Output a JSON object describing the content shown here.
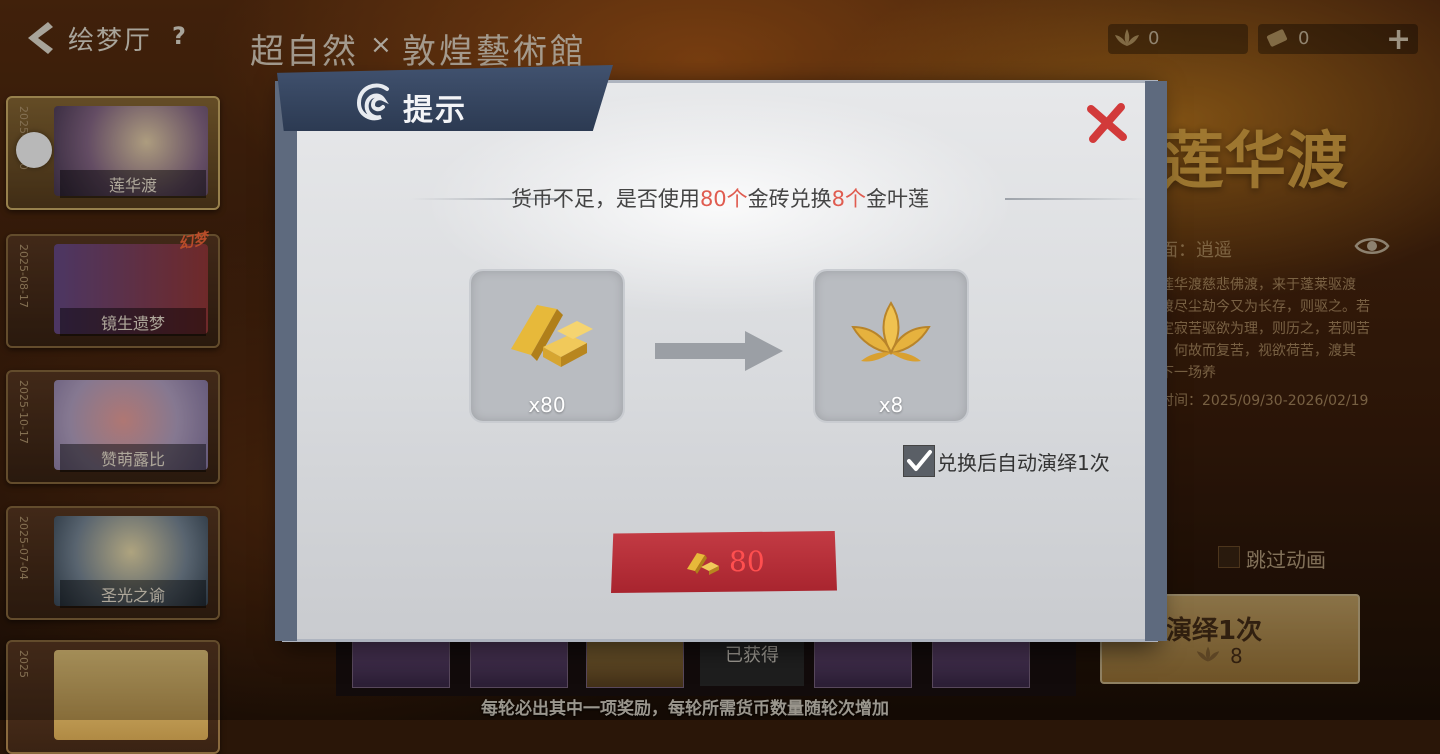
{
  "header": {
    "back_icon": "back-arrow-icon",
    "title": "绘梦厅",
    "help": "?",
    "collab_logo": "超自然",
    "collab_x": "×",
    "collab_museum": "敦煌藝術館"
  },
  "currency": [
    {
      "icon": "gold-lotus-icon",
      "value": "0"
    },
    {
      "icon": "scroll-ticket-icon",
      "value": "0"
    }
  ],
  "plus": "+",
  "event_list": [
    {
      "name": "莲华渡",
      "date": "2025-09-30",
      "active": true
    },
    {
      "name": "镜生遗梦",
      "date": "2025-08-17",
      "badge": "幻梦"
    },
    {
      "name": "赞萌露比",
      "date": "2025-10-17"
    },
    {
      "name": "圣光之谕",
      "date": "2025-07-04"
    },
    {
      "name": "",
      "date": "2025"
    }
  ],
  "event_info": {
    "big_title": "莲华渡",
    "lines": [
      "面：逍遥",
      "莲华渡慈悲佛渡，来于蓬莱驱渡",
      "渡尽尘劫今又为长存，则驱之。若",
      "定寂苦驱欲为理，则历之，若则苦",
      "，何故而复苦，视欲荷苦，渡其",
      "下一场养",
      "时间：2025/09/30-2026/02/19"
    ]
  },
  "skip_label": "跳过动画",
  "perform": {
    "label": "演绎1次",
    "cost": "8"
  },
  "rewards": {
    "obtained_label": "已获得"
  },
  "bottom_hint": "每轮必出其中一项奖励，每轮所需货币数量随轮次增加",
  "modal": {
    "title": "提示",
    "prompt_pre": "货币不足，是否使用",
    "prompt_amount1": "80个",
    "prompt_mid": "金砖兑换",
    "prompt_amount2": "8个",
    "prompt_post": "金叶莲",
    "from_item": {
      "icon": "gold-brick-icon",
      "qty": "x80"
    },
    "to_item": {
      "icon": "golden-lotus-icon",
      "qty": "x8"
    },
    "auto_checked": true,
    "auto_label": "兑换后自动演绎1次",
    "confirm_cost": "80"
  },
  "colors": {
    "highlight": "#e05c50",
    "confirm_bg": "#b42d37",
    "modal_bg": "#dcdee1"
  }
}
